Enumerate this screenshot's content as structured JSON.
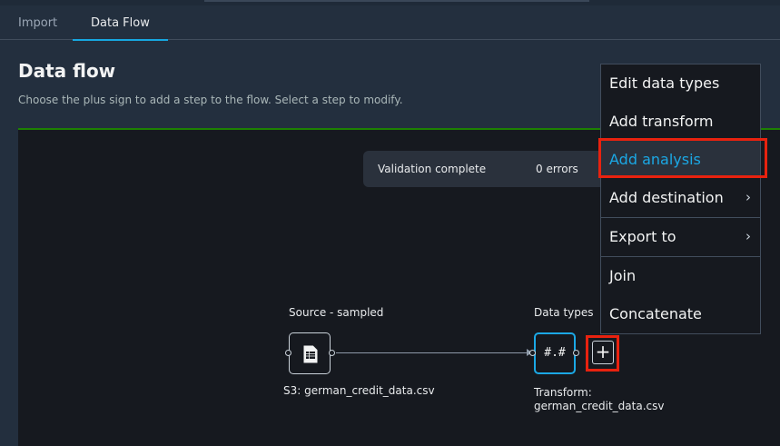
{
  "tabs": [
    {
      "label": "Import"
    },
    {
      "label": "Data Flow",
      "active": true
    }
  ],
  "page": {
    "title": "Data flow",
    "description": "Choose the plus sign to add a step to the flow. Select a step to modify."
  },
  "validation": {
    "status": "Validation complete",
    "errors": "0 errors"
  },
  "nodes": {
    "source": {
      "title": "Source - sampled",
      "caption": "S3: german_credit_data.csv",
      "icon": "file-table-icon"
    },
    "types": {
      "title": "Data types",
      "glyph": "#.#",
      "caption_line1": "Transform:",
      "caption_line2": "german_credit_data.csv"
    },
    "add_button_glyph": "+"
  },
  "menu": {
    "items": [
      {
        "label": "Edit data types",
        "submenu": false
      },
      {
        "label": "Add transform",
        "submenu": false
      },
      {
        "label": "Add analysis",
        "submenu": false,
        "highlighted": true
      },
      {
        "label": "Add destination",
        "submenu": true
      },
      {
        "label": "Export to",
        "submenu": true
      },
      {
        "label": "Join",
        "submenu": false
      },
      {
        "label": "Concatenate",
        "submenu": false
      }
    ],
    "chevron": "›"
  },
  "colors": {
    "accent": "#1ba8e5",
    "highlight": "#e8220f",
    "success": "#1d8102"
  }
}
